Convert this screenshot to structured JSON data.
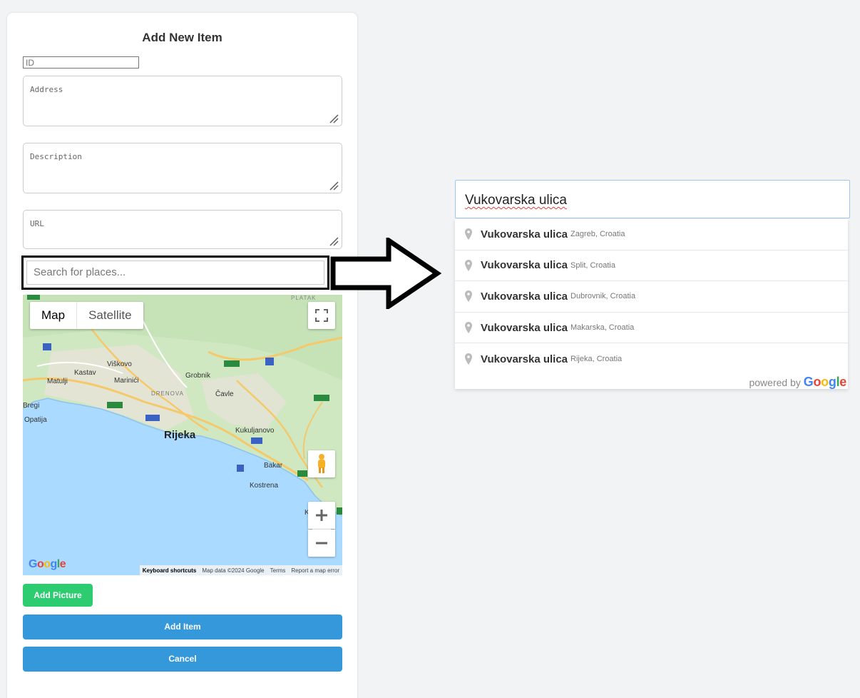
{
  "form": {
    "title": "Add New Item",
    "id_placeholder": "ID",
    "address_placeholder": "Address",
    "description_placeholder": "Description",
    "url_placeholder": "URL",
    "search_placeholder": "Search for places...",
    "add_picture_label": "Add Picture",
    "add_item_label": "Add Item",
    "cancel_label": "Cancel"
  },
  "map": {
    "type_map_label": "Map",
    "type_satellite_label": "Satellite",
    "places": {
      "rijeka": "Rijeka",
      "viskovo": "Viškovo",
      "kastav": "Kastav",
      "matulji": "Matulji",
      "marinici": "Marinići",
      "grobnik": "Grobnik",
      "drenova": "DRENOVA",
      "cavle": "Čavle",
      "bregi": "Bregi",
      "opatija": "Opatija",
      "kukuljanovo": "Kukuljanovo",
      "bakar": "Bakar",
      "kostrena": "Kostrena",
      "kral": "Kral",
      "plataк": "PLATAK"
    },
    "footer": {
      "shortcuts": "Keyboard shortcuts",
      "data": "Map data ©2024 Google",
      "terms": "Terms",
      "report": "Report a map error"
    }
  },
  "autocomplete": {
    "query": "Vukovarska ulica",
    "results": [
      {
        "main": "Vukovarska ulica",
        "secondary": "Zagreb, Croatia"
      },
      {
        "main": "Vukovarska ulica",
        "secondary": "Split, Croatia"
      },
      {
        "main": "Vukovarska ulica",
        "secondary": "Dubrovnik, Croatia"
      },
      {
        "main": "Vukovarska ulica",
        "secondary": "Makarska, Croatia"
      },
      {
        "main": "Vukovarska ulica",
        "secondary": "Rijeka, Croatia"
      }
    ],
    "powered_by": "powered by"
  },
  "colors": {
    "add_picture": "#2ecc71",
    "primary_button": "#3498db",
    "sea": "#aadaff",
    "land": "#cfe8c2"
  },
  "icons": [
    "resize-grip-icon",
    "fullscreen-icon",
    "pegman-icon",
    "zoom-in-icon",
    "zoom-out-icon",
    "arrow-right-icon",
    "location-pin-icon",
    "google-logo"
  ]
}
